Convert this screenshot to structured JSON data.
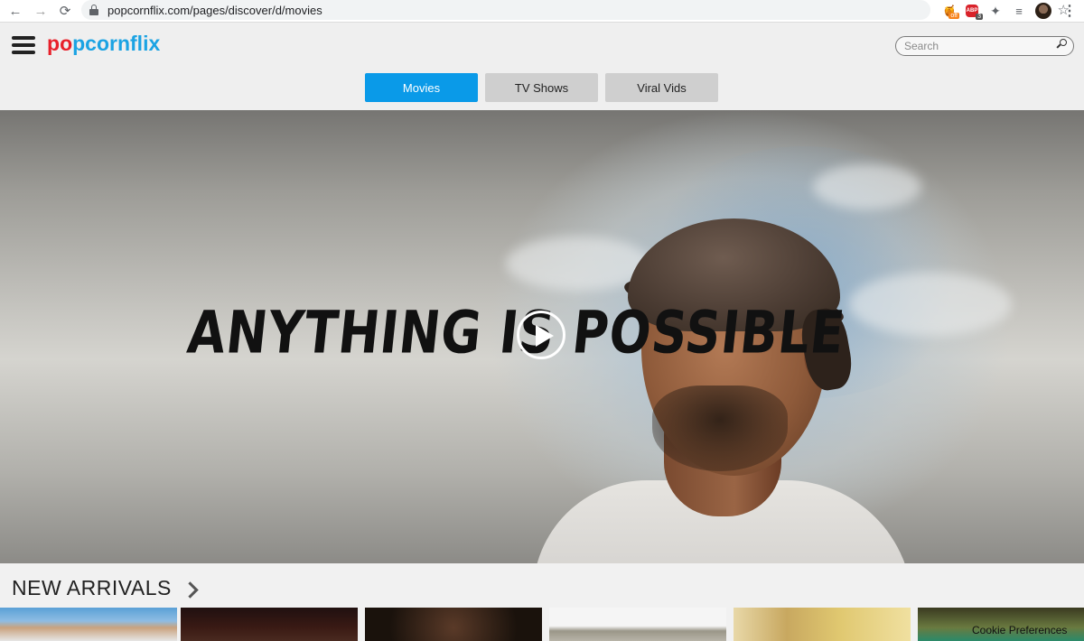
{
  "browser": {
    "url": "popcornflix.com/pages/discover/d/movies",
    "honey_badge": "off",
    "abp_label": "ABP",
    "abp_badge": "3",
    "icons": [
      "back-arrow-icon",
      "forward-arrow-icon",
      "reload-icon",
      "lock-icon",
      "star-icon",
      "extension-puzzle-icon",
      "media-control-icon",
      "kebab-menu-icon"
    ]
  },
  "header": {
    "logo_first": "p",
    "logo_ring": "o",
    "logo_rest": "pcornflix",
    "search_placeholder": "Search"
  },
  "tabs": [
    {
      "label": "Movies",
      "active": true
    },
    {
      "label": "TV Shows",
      "active": false
    },
    {
      "label": "Viral Vids",
      "active": false
    }
  ],
  "hero": {
    "title": "ANYTHING IS POSSIBLE"
  },
  "new_arrivals": {
    "title": "NEW ARRIVALS"
  },
  "cookie": {
    "label": "Cookie Preferences"
  },
  "colors": {
    "accent": "#0a9ae8",
    "logo_red": "#e8202a",
    "logo_blue": "#1ba3e3"
  }
}
